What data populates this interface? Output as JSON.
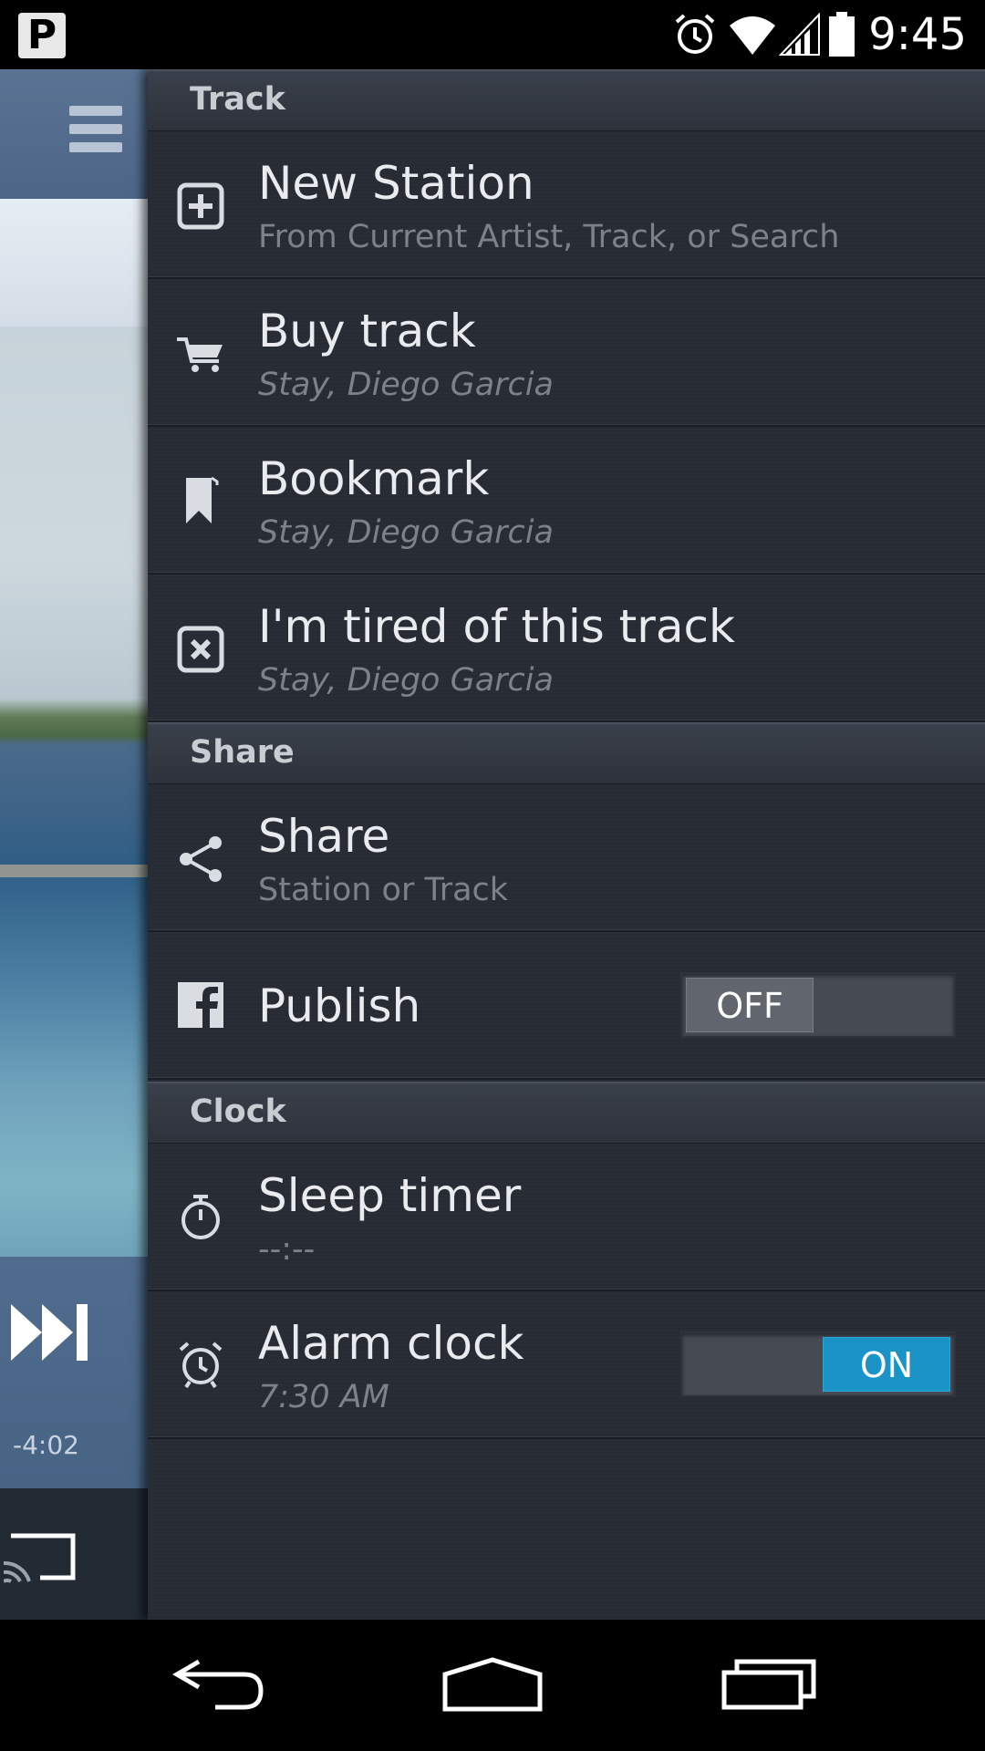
{
  "status_bar": {
    "app_badge": "P",
    "time": "9:45"
  },
  "now_playing": {
    "time_remaining": "-4:02"
  },
  "drawer": {
    "sections": {
      "track": "Track",
      "share": "Share",
      "clock": "Clock"
    },
    "items": {
      "new_station": {
        "title": "New Station",
        "subtitle": "From Current Artist, Track, or Search",
        "icon": "add-box-icon"
      },
      "buy_track": {
        "title": "Buy track",
        "subtitle": "Stay, Diego Garcia",
        "icon": "cart-icon"
      },
      "bookmark": {
        "title": "Bookmark",
        "subtitle": "Stay, Diego Garcia",
        "icon": "bookmark-icon"
      },
      "tired": {
        "title": "I'm tired of this track",
        "subtitle": "Stay, Diego Garcia",
        "icon": "close-box-icon"
      },
      "share": {
        "title": "Share",
        "subtitle": "Station or Track",
        "icon": "share-icon"
      },
      "publish": {
        "title": "Publish",
        "toggle": "OFF",
        "icon": "facebook-icon"
      },
      "sleep_timer": {
        "title": "Sleep timer",
        "subtitle": "--:--",
        "icon": "timer-icon"
      },
      "alarm_clock": {
        "title": "Alarm clock",
        "subtitle": "7:30 AM",
        "toggle": "ON",
        "icon": "alarm-clock-icon"
      }
    }
  },
  "colors": {
    "drawer_bg": "#262b34",
    "toggle_on": "#1a93c6",
    "header_bg": "#4d6688"
  }
}
